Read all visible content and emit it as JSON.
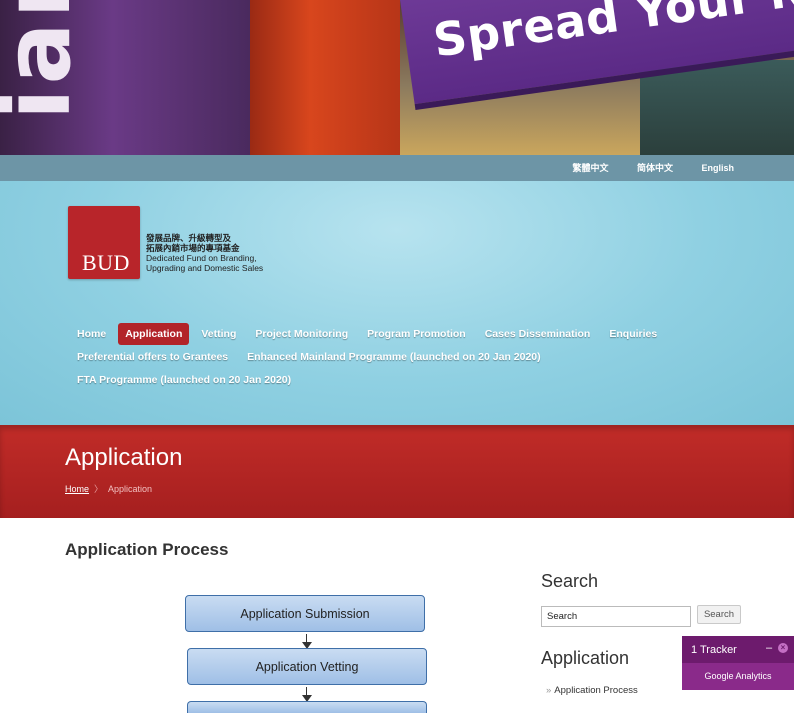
{
  "banner": {
    "sign_text": "Spread Your Name",
    "left_text": "ian"
  },
  "top_bar": {
    "languages": [
      "繁體中文",
      "简体中文",
      "English"
    ]
  },
  "logo": {
    "mark": "BUD",
    "zh_line_1": "發展品牌、升級轉型及",
    "zh_line_2": "拓展內銷市場的專項基金",
    "en_line_1": "Dedicated Fund on Branding,",
    "en_line_2": "Upgrading and Domestic Sales"
  },
  "nav": {
    "row1": [
      "Home",
      "Application",
      "Vetting",
      "Project Monitoring",
      "Program Promotion",
      "Cases Dissemination",
      "Enquiries"
    ],
    "row2": [
      "Preferential offers to Grantees",
      "Enhanced Mainland Programme (launched on 20 Jan 2020)"
    ],
    "row3": [
      "FTA Programme (launched on 20 Jan 2020)"
    ],
    "active": "Application"
  },
  "title_band": {
    "title": "Application",
    "breadcrumb_home": "Home",
    "breadcrumb_separator": "〉",
    "breadcrumb_current": "Application"
  },
  "main": {
    "section_title": "Application Process",
    "flow_steps": [
      "Application Submission",
      "Application Vetting"
    ]
  },
  "sidebar": {
    "search_heading": "Search",
    "search_value": "Search",
    "search_button": "Search",
    "application_heading": "Application",
    "links": [
      "Application Process"
    ],
    "link_chevron": "»"
  },
  "tracker": {
    "title": "1 Tracker",
    "minimize": "–",
    "close": "×",
    "item": "Google Analytics"
  },
  "colors": {
    "brand_red": "#b22429",
    "header_blue": "#8fd0e2",
    "top_bar": "#6d95a6",
    "tracker_purple": "#6d1b6d"
  }
}
